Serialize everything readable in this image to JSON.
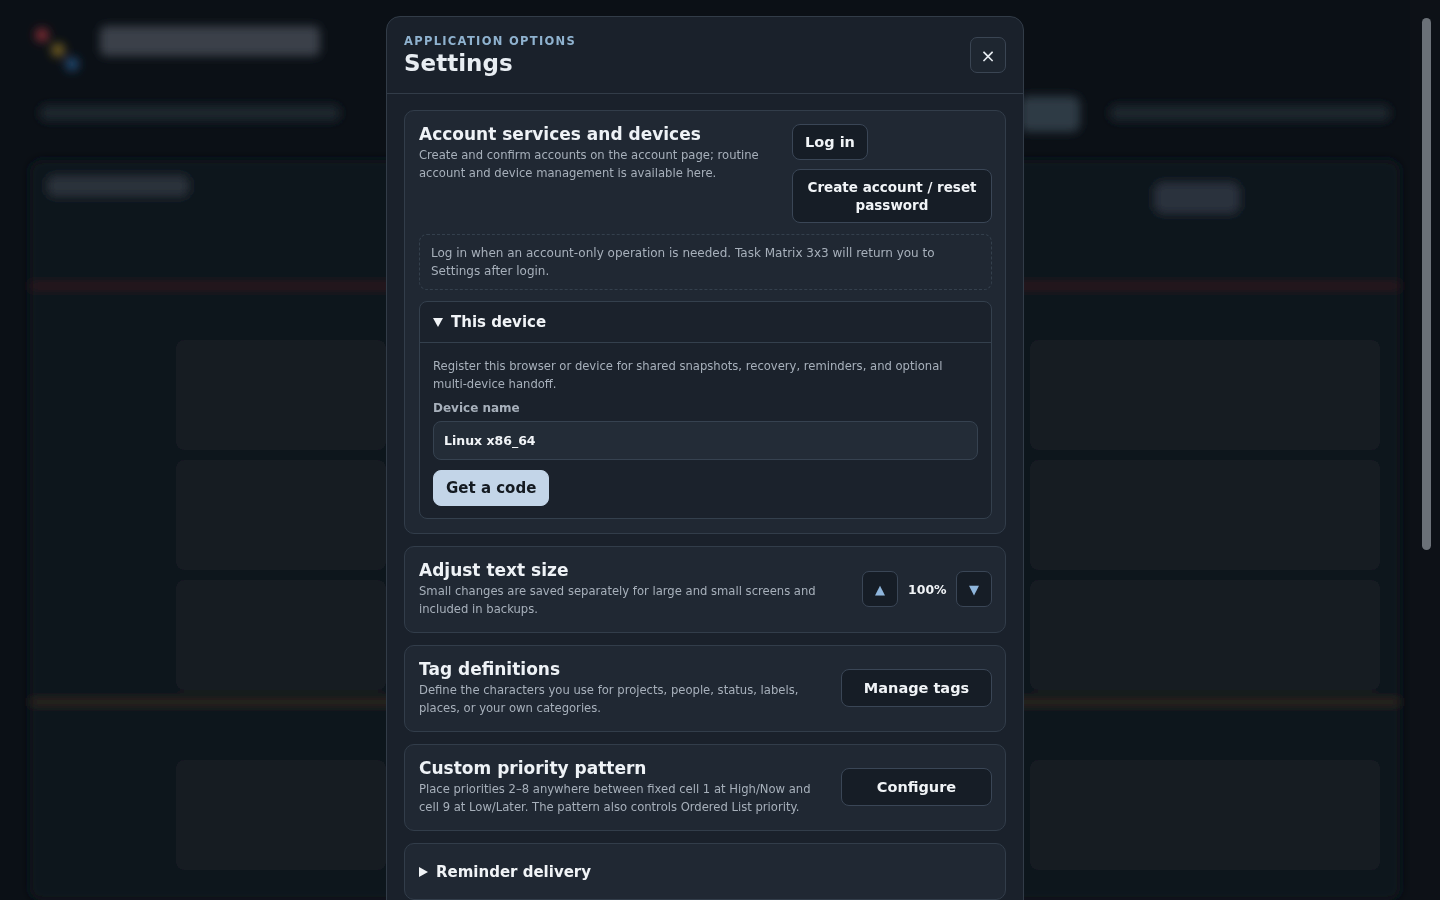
{
  "dialog": {
    "eyebrow": "APPLICATION OPTIONS",
    "title": "Settings",
    "close": "×",
    "sections": [
      {
        "kind": "account",
        "title": "Account services and devices",
        "description": "Create and confirm accounts on the account page; routine account and device management is available here.",
        "buttons": [
          "Log in",
          "Create account / reset password"
        ],
        "note": "Log in when an account-only operation is needed. Task Matrix 3x3 will return you to Settings after login.",
        "device": {
          "title": "This device",
          "expanded": true,
          "description": "Register this browser or device for shared snapshots, recovery, reminders, and optional multi-device handoff.",
          "field_label": "Device name",
          "field_value": "Linux x86_64",
          "button": "Get a code"
        }
      },
      {
        "kind": "stepper",
        "title": "Adjust text size",
        "description": "Small changes are saved separately for large and small screens and included in backups.",
        "up": "▲",
        "value": "100%",
        "down": "▼"
      },
      {
        "kind": "action",
        "title": "Tag definitions",
        "description": "Define the characters you use for projects, people, status, labels, places, or your own categories.",
        "button": "Manage tags"
      },
      {
        "kind": "action",
        "title": "Custom priority pattern",
        "description": "Place priorities 2–8 anywhere between fixed cell 1 at High/Now and cell 9 at Low/Later. The pattern also controls Ordered List priority.",
        "button": "Configure"
      },
      {
        "kind": "collapsible",
        "title": "Reminder delivery",
        "expanded": false
      }
    ]
  }
}
